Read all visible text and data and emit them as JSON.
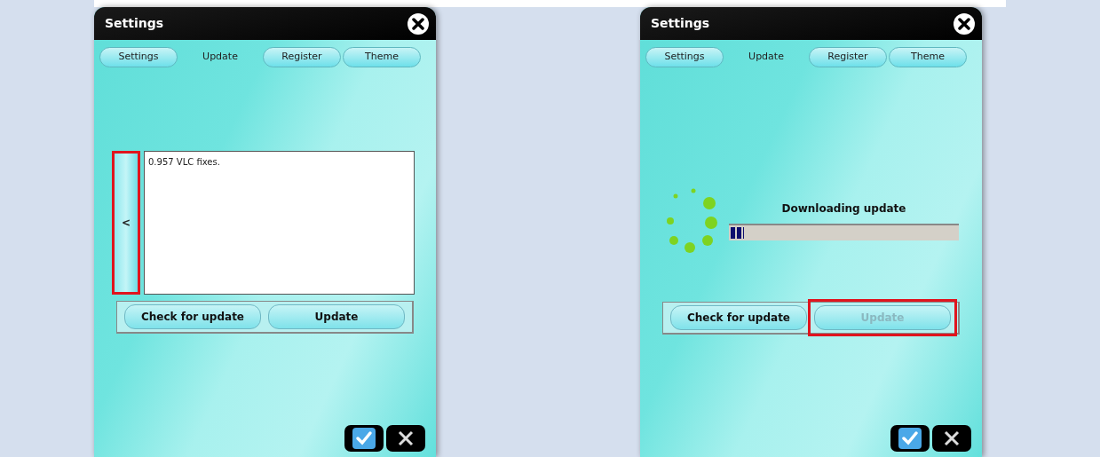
{
  "panels": [
    {
      "title": "Settings",
      "tabs": [
        {
          "label": "Settings",
          "selected": false
        },
        {
          "label": "Update",
          "selected": true
        },
        {
          "label": "Register",
          "selected": false
        },
        {
          "label": "Theme",
          "selected": false
        }
      ],
      "content": {
        "kind": "notes",
        "toggle": "<",
        "toggle_highlighted": true,
        "text": "0.957 VLC fixes."
      },
      "buttons": [
        {
          "label": "Check for update",
          "disabled": false,
          "highlighted": false
        },
        {
          "label": "Update",
          "disabled": false,
          "highlighted": false
        }
      ]
    },
    {
      "title": "Settings",
      "tabs": [
        {
          "label": "Settings",
          "selected": false
        },
        {
          "label": "Update",
          "selected": true
        },
        {
          "label": "Register",
          "selected": false
        },
        {
          "label": "Theme",
          "selected": false
        }
      ],
      "content": {
        "kind": "progress",
        "status": "Downloading update",
        "level": 0.06
      },
      "buttons": [
        {
          "label": "Check for update",
          "disabled": false,
          "highlighted": false
        },
        {
          "label": "Update",
          "disabled": true,
          "highlighted": true
        }
      ]
    }
  ]
}
